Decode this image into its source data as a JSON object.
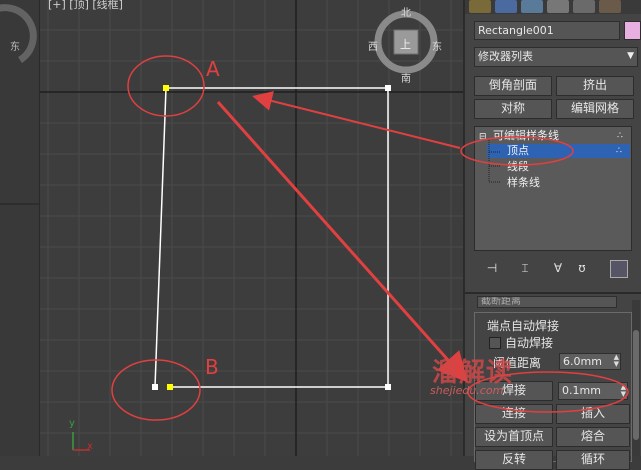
{
  "viewport": {
    "label": "[+] [顶] [线框]",
    "viewcube": {
      "north": "北",
      "south": "南",
      "east": "东",
      "west": "西",
      "face": "上"
    },
    "left_viewport_label": "东",
    "axis_x": "x",
    "axis_y": "y"
  },
  "panel": {
    "object_name": "Rectangle001",
    "modifier_list": "修改器列表",
    "buttons": {
      "chamfer_section": "倒角剖面",
      "extrude": "挤出",
      "symmetry": "对称",
      "edit_mesh": "编辑网格"
    },
    "stack": {
      "root": "可编辑样条线",
      "items": [
        "顶点",
        "线段",
        "样条线"
      ],
      "selected": "顶点"
    },
    "rollout": {
      "cut_label": "截断距离",
      "group_label": "端点自动焊接",
      "auto_weld": "自动焊接",
      "threshold_label": "阈值距离",
      "threshold_value": "6.0mm",
      "weld_button": "焊接",
      "weld_value": "0.1mm",
      "connect": "连接",
      "insert": "插入",
      "make_first": "设为首顶点",
      "fuse": "熔合",
      "reverse": "反转",
      "cycle": "循环"
    }
  },
  "annotations": {
    "point_a": "A",
    "point_b": "B",
    "color": "#e04040"
  },
  "watermark": {
    "text": "溜解读",
    "url": "shejiedu.com"
  },
  "colors": {
    "selected_item": "#2e63b4",
    "rect_line": "#ffffff",
    "vertex_selected": "#ffff00"
  }
}
